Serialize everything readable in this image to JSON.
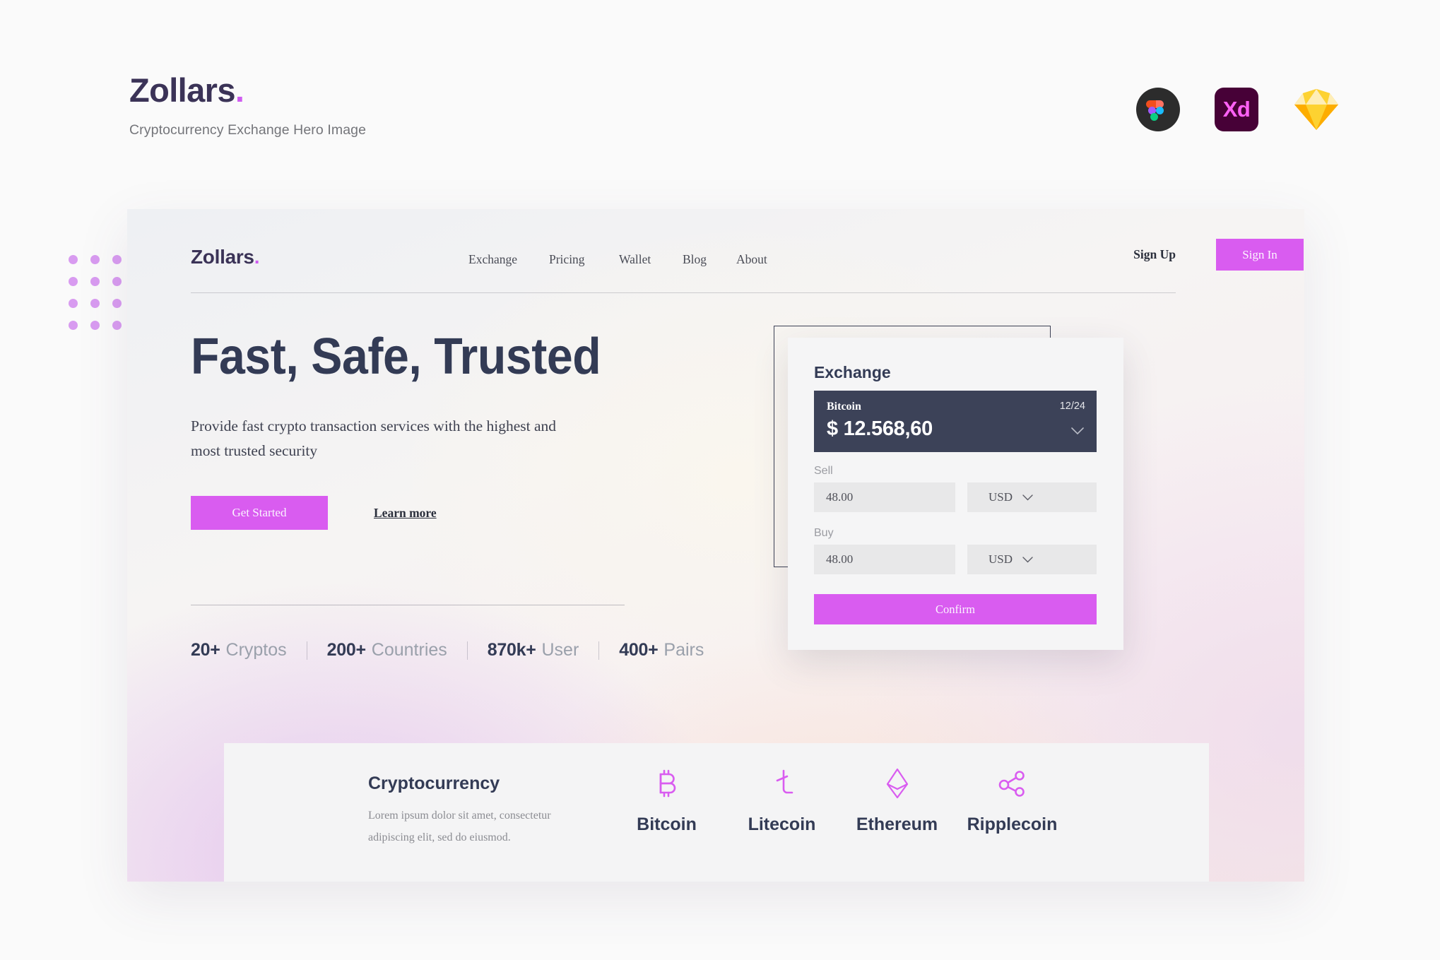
{
  "presentation": {
    "brand": "Zollars",
    "brand_dot": ".",
    "subtitle": "Cryptocurrency Exchange Hero Image",
    "tools": [
      {
        "name": "figma",
        "label": "Figma"
      },
      {
        "name": "adobe-xd",
        "label": "Xd"
      },
      {
        "name": "sketch",
        "label": "Sketch"
      }
    ]
  },
  "hero": {
    "nav": {
      "logo": "Zollars",
      "logo_dot": ".",
      "links": [
        "Exchange",
        "Pricing",
        "Wallet",
        "Blog",
        "About"
      ],
      "sign_up": "Sign Up",
      "sign_in": "Sign In"
    },
    "headline": "Fast, Safe, Trusted",
    "subhead": "Provide fast crypto transaction services with the highest and most trusted security",
    "cta_primary": "Get Started",
    "cta_secondary": "Learn more",
    "stats": [
      {
        "value": "20+",
        "label": "Cryptos"
      },
      {
        "value": "200+",
        "label": "Countries"
      },
      {
        "value": "870k+",
        "label": "User"
      },
      {
        "value": "400+",
        "label": "Pairs"
      }
    ]
  },
  "exchange": {
    "title": "Exchange",
    "coin": "Bitcoin",
    "date": "12/24",
    "price": "$ 12.568,60",
    "sell_label": "Sell",
    "sell_amount": "48.00",
    "sell_currency": "USD",
    "buy_label": "Buy",
    "buy_amount": "48.00",
    "buy_currency": "USD",
    "confirm": "Confirm"
  },
  "crypto_strip": {
    "title": "Cryptocurrency",
    "description": "Lorem ipsum dolor sit amet, consectetur adipiscing elit, sed do eiusmod.",
    "coins": [
      {
        "name": "Bitcoin",
        "icon": "bitcoin-icon"
      },
      {
        "name": "Litecoin",
        "icon": "litecoin-icon"
      },
      {
        "name": "Ethereum",
        "icon": "ethereum-icon"
      },
      {
        "name": "Ripplecoin",
        "icon": "ripple-icon"
      }
    ]
  },
  "colors": {
    "accent": "#d95cf0",
    "navy": "#333b55",
    "panel_navy": "#3c4258",
    "dot_purple": "#d89bf0",
    "page_bg": "#fafafa"
  }
}
